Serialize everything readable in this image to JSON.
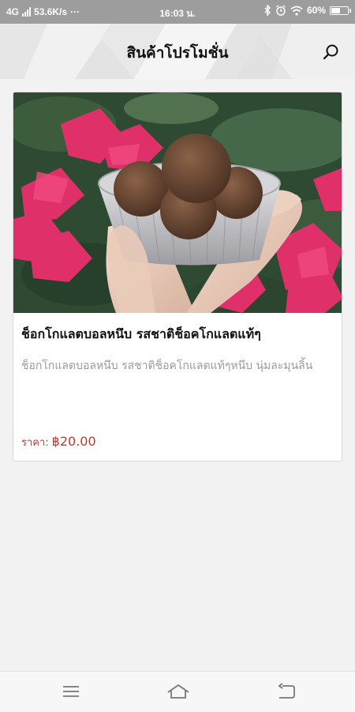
{
  "status_bar": {
    "network": "4G",
    "speed": "53.6K/s",
    "more": "···",
    "time": "16:03 น.",
    "battery": "60%",
    "battery_level": 0.6
  },
  "header": {
    "title": "สินค้าโปรโมชั่น",
    "search_icon": "search-icon"
  },
  "product": {
    "name": "ช็อกโกแลตบอลหนึบ รสชาติช็อคโกแลตแท้ๆ",
    "description": "ช็อกโกแลตบอลหนึบ รสชาติช็อคโกแลตแท้ๆหนึบ นุ่มละมุนลิ้น",
    "price_label": "ราคา:",
    "price": "฿20.00",
    "price_color": "#c0392b"
  },
  "nav": {
    "icons": [
      "menu-icon",
      "home-icon",
      "back-icon"
    ]
  }
}
